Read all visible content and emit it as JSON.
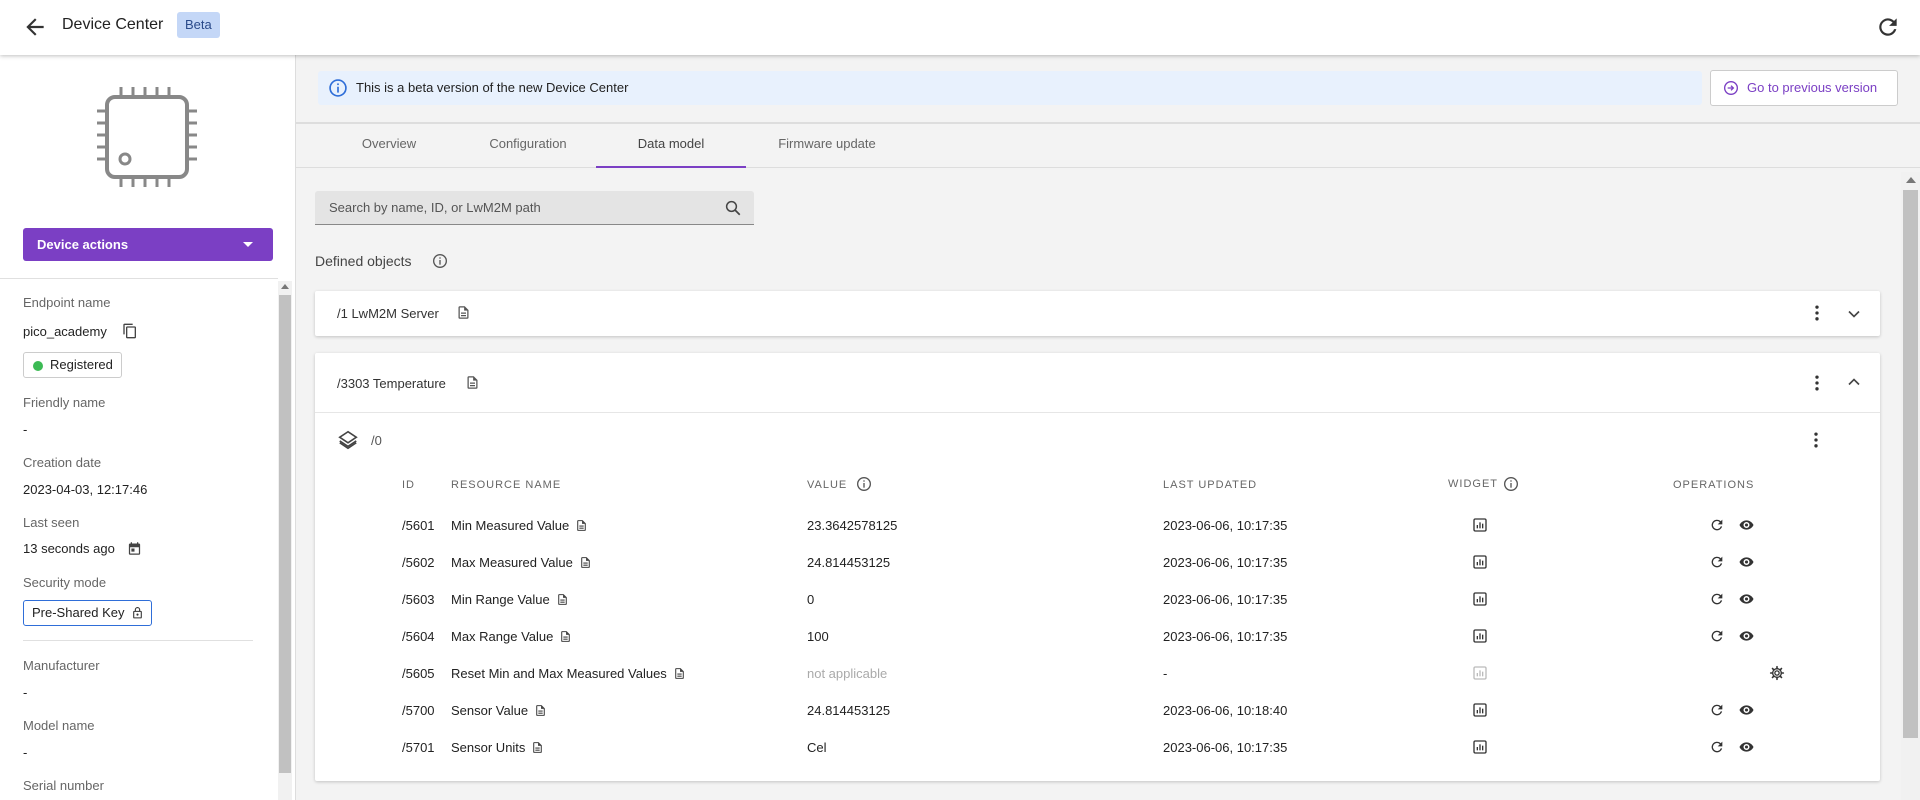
{
  "app": {
    "title": "Device Center",
    "badge": "Beta"
  },
  "sidebar": {
    "device_actions_label": "Device actions",
    "fields": {
      "endpoint_label": "Endpoint name",
      "endpoint_value": "pico_academy",
      "status": "Registered",
      "friendly_label": "Friendly name",
      "friendly_value": "-",
      "creation_label": "Creation date",
      "creation_value": "2023-04-03, 12:17:46",
      "lastseen_label": "Last seen",
      "lastseen_value": "13 seconds ago",
      "security_label": "Security mode",
      "security_value": "Pre-Shared Key",
      "manufacturer_label": "Manufacturer",
      "manufacturer_value": "-",
      "model_label": "Model name",
      "model_value": "-",
      "serial_label": "Serial number"
    }
  },
  "banner": {
    "text": "This is a beta version of the new Device Center",
    "prev_label": "Go to previous version"
  },
  "tabs": [
    "Overview",
    "Configuration",
    "Data model",
    "Firmware update"
  ],
  "search": {
    "placeholder": "Search by name, ID, or LwM2M path"
  },
  "defined_objects_label": "Defined objects",
  "objects": [
    {
      "title": "/1 LwM2M Server"
    },
    {
      "title": "/3303 Temperature",
      "instance": "/0"
    }
  ],
  "table": {
    "headers": {
      "id": "ID",
      "name": "RESOURCE NAME",
      "value": "VALUE",
      "updated": "LAST UPDATED",
      "widget": "WIDGET",
      "ops": "OPERATIONS"
    },
    "rows": [
      {
        "id": "/5601",
        "name": "Min Measured Value",
        "value": "23.3642578125",
        "updated": "2023-06-06, 10:17:35"
      },
      {
        "id": "/5602",
        "name": "Max Measured Value",
        "value": "24.814453125",
        "updated": "2023-06-06, 10:17:35"
      },
      {
        "id": "/5603",
        "name": "Min Range Value",
        "value": "0",
        "updated": "2023-06-06, 10:17:35"
      },
      {
        "id": "/5604",
        "name": "Max Range Value",
        "value": "100",
        "updated": "2023-06-06, 10:17:35"
      },
      {
        "id": "/5605",
        "name": "Reset Min and Max Measured Values",
        "value": "not applicable",
        "updated": "-"
      },
      {
        "id": "/5700",
        "name": "Sensor Value",
        "value": "24.814453125",
        "updated": "2023-06-06, 10:18:40"
      },
      {
        "id": "/5701",
        "name": "Sensor Units",
        "value": "Cel",
        "updated": "2023-06-06, 10:17:35"
      }
    ]
  },
  "colors": {
    "accent": "#7b3fc4",
    "info": "#2f6ed8",
    "success": "#3cba54"
  }
}
